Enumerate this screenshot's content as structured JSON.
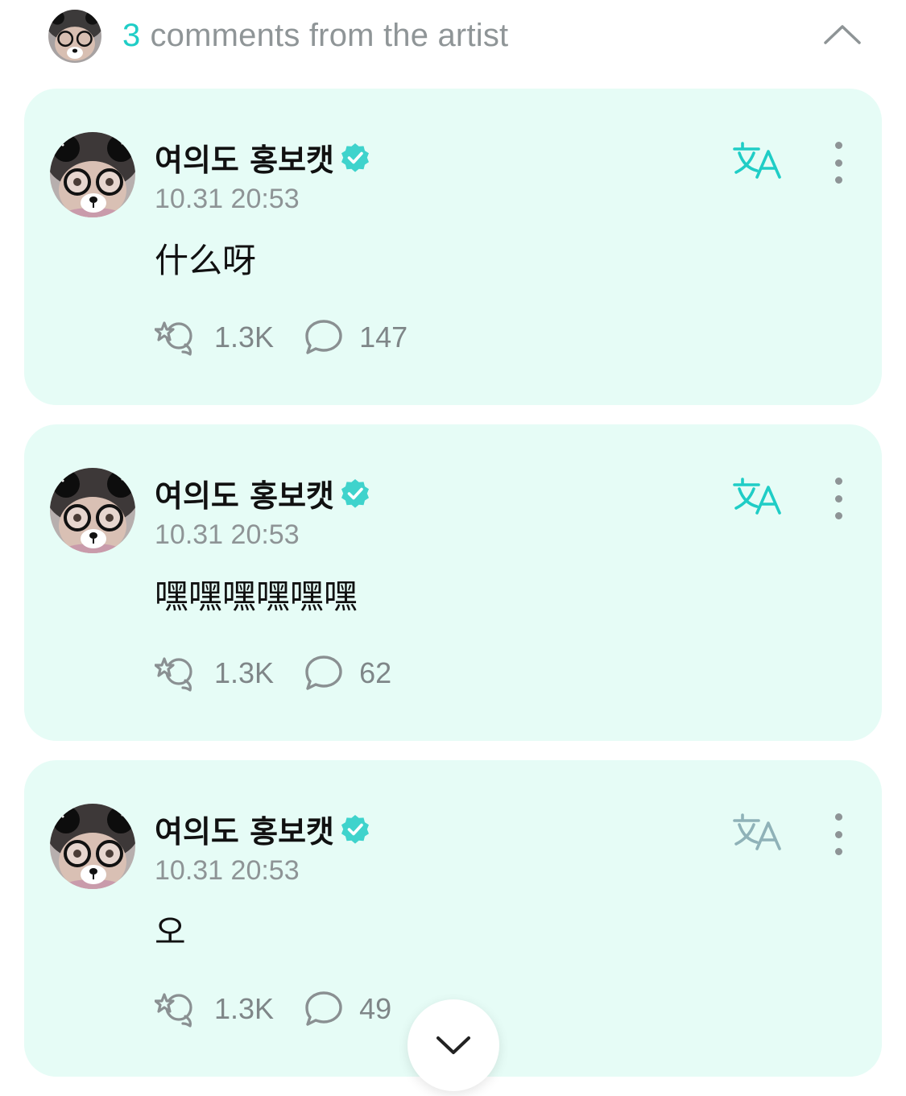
{
  "header": {
    "count": "3",
    "title_text": "comments from the artist",
    "collapse_icon": "chevron-up-icon"
  },
  "comments": [
    {
      "author": "여의도 홍보캣",
      "verified_icon": "verified-badge-icon",
      "time": "10.31 20:53",
      "text": "什么呀",
      "likes": "1.3K",
      "replies": "147",
      "translate_icon": "translate-icon"
    },
    {
      "author": "여의도 홍보캣",
      "verified_icon": "verified-badge-icon",
      "time": "10.31 20:53",
      "text": "嘿嘿嘿嘿嘿嘿",
      "likes": "1.3K",
      "replies": "62",
      "translate_icon": "translate-icon"
    },
    {
      "author": "여의도 홍보캣",
      "verified_icon": "verified-badge-icon",
      "time": "10.31 20:53",
      "text": "오",
      "likes": "1.3K",
      "replies": "49",
      "translate_icon": "translate-icon"
    }
  ],
  "colors": {
    "accent": "#1fcdc6",
    "card_bg": "#e6fcf6",
    "muted_text": "#8e9496",
    "translate_active": "#1fcdc6",
    "translate_inactive": "#8fb2b8"
  },
  "scroll_down_icon": "chevron-down-icon"
}
